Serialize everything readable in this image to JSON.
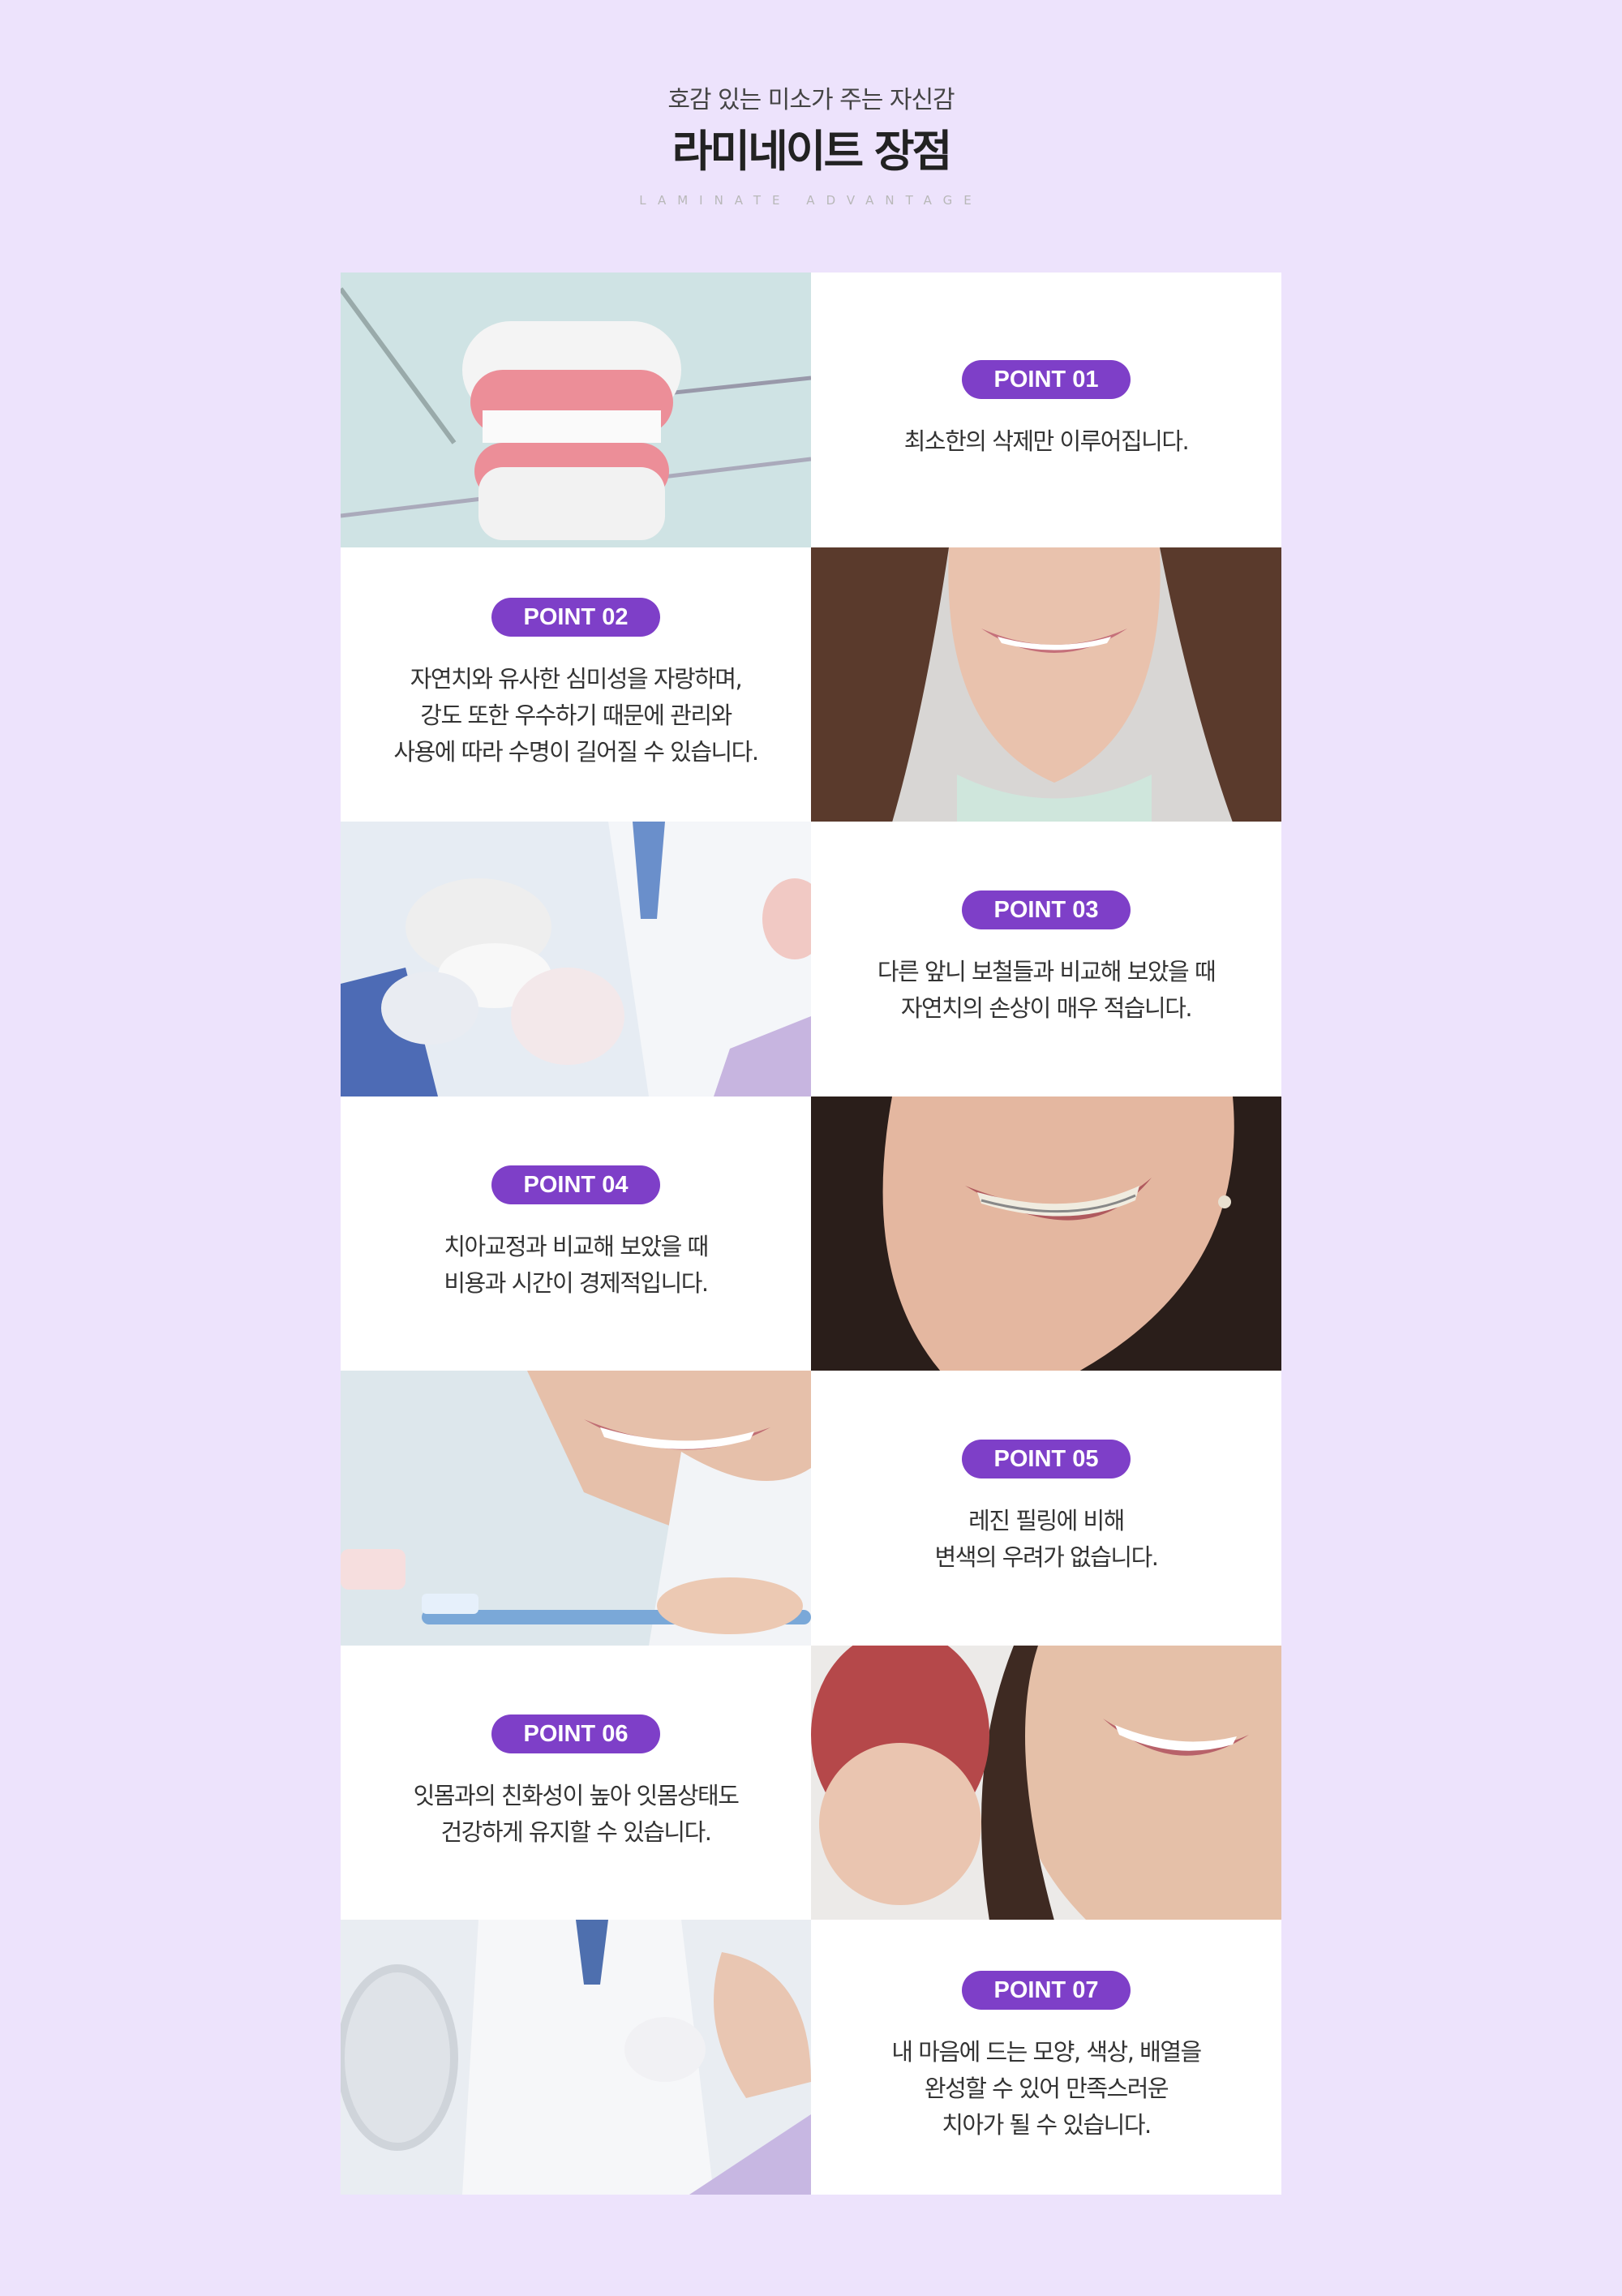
{
  "header": {
    "subtitle": "호감 있는 미소가 주는 자신감",
    "title": "라미네이트 장점",
    "english": "LAMINATE ADVANTAGE"
  },
  "points": [
    {
      "badge": "POINT 01",
      "text": "최소한의 삭제만 이루어집니다.",
      "image": "dental-model-with-tools"
    },
    {
      "badge": "POINT 02",
      "text": "자연치와 유사한 심미성을 자랑하며,\n강도 또한 우수하기 때문에 관리와\n사용에 따라 수명이 길어질 수 있습니다.",
      "image": "smiling-woman"
    },
    {
      "badge": "POINT 03",
      "text": "다른 앞니 보철들과 비교해 보았을 때\n자연치의 손상이 매우 적습니다.",
      "image": "dentist-holding-model"
    },
    {
      "badge": "POINT 04",
      "text": "치아교정과 비교해 보았을 때\n비용과 시간이 경제적입니다.",
      "image": "smile-with-braces"
    },
    {
      "badge": "POINT 05",
      "text": "레진 필링에 비해\n변색의 우려가 없습니다.",
      "image": "woman-with-toothbrush"
    },
    {
      "badge": "POINT 06",
      "text": "잇몸과의 친화성이 높아 잇몸상태도\n건강하게 유지할 수 있습니다.",
      "image": "woman-with-apple"
    },
    {
      "badge": "POINT 07",
      "text": "내 마음에 드는 모양, 색상, 배열을\n완성할 수 있어 만족스러운\n치아가 될 수 있습니다.",
      "image": "dentist-with-patient-mirror"
    }
  ],
  "colors": {
    "background": "#ede3fc",
    "badge": "#7e3fc8",
    "card": "#ffffff"
  }
}
